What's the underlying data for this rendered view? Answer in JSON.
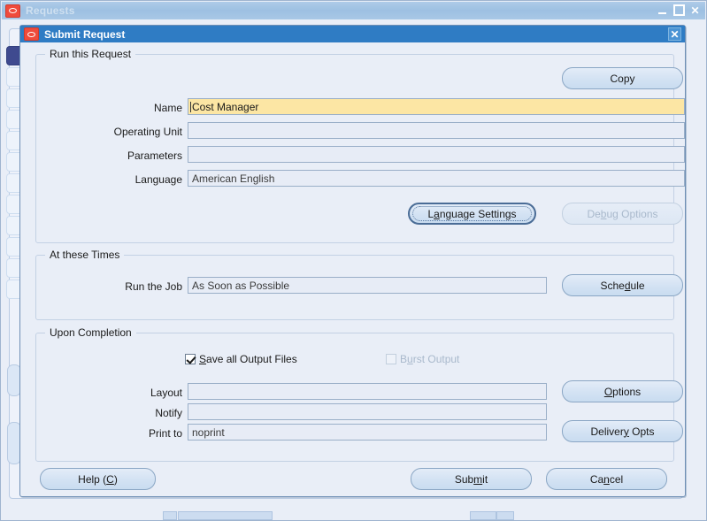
{
  "background_window": {
    "title": "Requests",
    "logo_icon": "oracle-logo-icon",
    "minimize_icon": "minimize-icon",
    "maximize_icon": "maximize-icon",
    "close_icon": "close-icon"
  },
  "dialog": {
    "title": "Submit Request",
    "logo_icon": "oracle-logo-icon",
    "close_icon": "close-icon",
    "groups": {
      "run_this_request": {
        "legend": "Run this Request",
        "copy_button": "Copy",
        "fields": [
          {
            "label": "Name",
            "value": "Cost Manager",
            "active": true
          },
          {
            "label": "Operating Unit",
            "value": "",
            "active": false
          },
          {
            "label": "Parameters",
            "value": "",
            "active": false
          },
          {
            "label": "Language",
            "value": "American English",
            "active": false
          }
        ],
        "language_settings_button": "Language Settings",
        "debug_options_button": "Debug Options"
      },
      "at_these_times": {
        "legend": "At these Times",
        "run_the_job_label": "Run the Job",
        "run_the_job_value": "As Soon as Possible",
        "schedule_button": "Schedule"
      },
      "upon_completion": {
        "legend": "Upon Completion",
        "save_all_output_files_label": "Save all Output Files",
        "save_all_output_files_checked": true,
        "burst_output_label": "Burst Output",
        "burst_output_checked": false,
        "fields": [
          {
            "label": "Layout",
            "value": ""
          },
          {
            "label": "Notify",
            "value": ""
          },
          {
            "label": "Print to",
            "value": "noprint"
          }
        ],
        "options_button": "Options",
        "delivery_opts_button": "Delivery Opts"
      }
    },
    "footer": {
      "help_button": "Help (C)",
      "submit_button": "Submit",
      "cancel_button": "Cancel"
    }
  },
  "colors": {
    "dialog_titlebar": "#2f7cc4",
    "active_field": "#fce6a4",
    "window_background": "#e9eef7",
    "button_face": "#d3e2f3",
    "selected_row": "#3f4a8f",
    "logo_red": "#ef4b3c"
  }
}
